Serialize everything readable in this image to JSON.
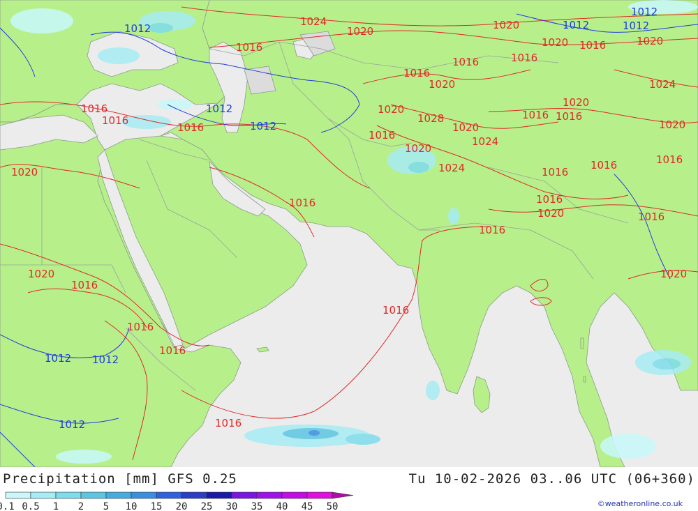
{
  "header": {
    "left_title": "Precipitation [mm]  GFS 0.25",
    "right_title": "Tu 10-02-2026 03..06 UTC (06+360)",
    "credit": "©weatheronline.co.uk"
  },
  "legend": {
    "items": [
      {
        "label": "0.1",
        "color": "#c8f8fa"
      },
      {
        "label": "0.5",
        "color": "#a6ecf4"
      },
      {
        "label": "1",
        "color": "#7edcec"
      },
      {
        "label": "2",
        "color": "#5cc6e2"
      },
      {
        "label": "5",
        "color": "#44acde"
      },
      {
        "label": "10",
        "color": "#3a8ee0"
      },
      {
        "label": "15",
        "color": "#2f62de"
      },
      {
        "label": "20",
        "color": "#2a3ec8"
      },
      {
        "label": "25",
        "color": "#1a1aa8"
      },
      {
        "label": "30",
        "color": "#7a16e0"
      },
      {
        "label": "35",
        "color": "#9e12e8"
      },
      {
        "label": "40",
        "color": "#c20ee4"
      },
      {
        "label": "45",
        "color": "#e010e0"
      },
      {
        "label": "50",
        "color": "#b00ca8"
      }
    ]
  },
  "colors": {
    "land": "#b7f08a",
    "sea": "#ececec",
    "highland": "#dcdcdc",
    "isobar_red": "#e02828",
    "isobar_blue": "#1e3cdc",
    "border": "#9aa0a0"
  },
  "isobar_labels": [
    {
      "text": "1024",
      "color": "red"
    },
    {
      "text": "1020",
      "color": "red"
    },
    {
      "text": "1016",
      "color": "red"
    },
    {
      "text": "1012",
      "color": "blue"
    },
    {
      "text": "1020",
      "color": "red"
    },
    {
      "text": "1016",
      "color": "red"
    },
    {
      "text": "1012",
      "color": "blue"
    },
    {
      "text": "1016",
      "color": "red"
    },
    {
      "text": "1016",
      "color": "red"
    },
    {
      "text": "1016",
      "color": "red"
    },
    {
      "text": "1012",
      "color": "blue"
    },
    {
      "text": "1012",
      "color": "blue"
    },
    {
      "text": "1020",
      "color": "red"
    },
    {
      "text": "1016",
      "color": "red"
    },
    {
      "text": "1020",
      "color": "red"
    },
    {
      "text": "1016",
      "color": "red"
    },
    {
      "text": "1016",
      "color": "red"
    },
    {
      "text": "1016",
      "color": "red"
    },
    {
      "text": "1012",
      "color": "blue"
    },
    {
      "text": "1012",
      "color": "blue"
    },
    {
      "text": "1012",
      "color": "blue"
    },
    {
      "text": "1016",
      "color": "red"
    },
    {
      "text": "1016",
      "color": "red"
    },
    {
      "text": "1016",
      "color": "red"
    },
    {
      "text": "1020",
      "color": "red"
    },
    {
      "text": "1020",
      "color": "red"
    },
    {
      "text": "1028",
      "color": "red"
    },
    {
      "text": "1020",
      "color": "red"
    },
    {
      "text": "1024",
      "color": "red"
    },
    {
      "text": "1024",
      "color": "red"
    },
    {
      "text": "1016",
      "color": "red"
    },
    {
      "text": "1016",
      "color": "red"
    },
    {
      "text": "1020",
      "color": "red"
    },
    {
      "text": "1016",
      "color": "red"
    },
    {
      "text": "1016",
      "color": "red"
    },
    {
      "text": "1016",
      "color": "red"
    },
    {
      "text": "1016",
      "color": "red"
    },
    {
      "text": "1020",
      "color": "red"
    },
    {
      "text": "1016",
      "color": "red"
    },
    {
      "text": "1016",
      "color": "red"
    },
    {
      "text": "1020",
      "color": "red"
    },
    {
      "text": "1016",
      "color": "red"
    },
    {
      "text": "1020",
      "color": "red"
    },
    {
      "text": "1020",
      "color": "red"
    },
    {
      "text": "1020",
      "color": "red"
    },
    {
      "text": "1016",
      "color": "red"
    },
    {
      "text": "1020",
      "color": "red"
    },
    {
      "text": "1024",
      "color": "red"
    },
    {
      "text": "1012",
      "color": "blue"
    },
    {
      "text": "1012",
      "color": "blue"
    },
    {
      "text": "1016",
      "color": "red"
    }
  ]
}
